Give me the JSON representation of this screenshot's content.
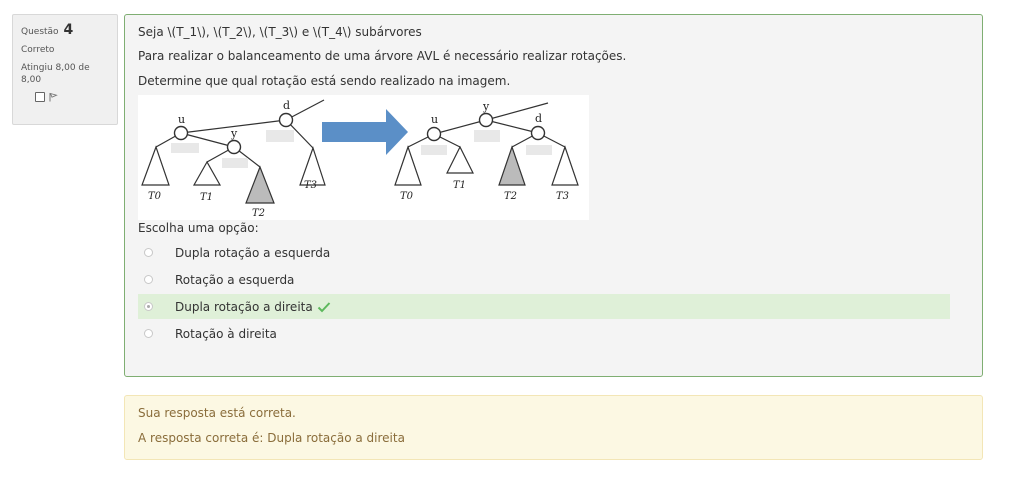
{
  "info": {
    "question_label": "Questão",
    "question_number": "4",
    "state": "Correto",
    "grade": "Atingiu 8,00 de 8,00"
  },
  "question": {
    "line1": "Seja \\(T_1\\), \\(T_2\\), \\(T_3\\) e \\(T_4\\)  subárvores",
    "line2": "Para realizar o balanceamento de uma árvore AVL é necessário realizar rotações.",
    "line3": "Determine que qual rotação está sendo realizado na imagem."
  },
  "figure": {
    "left_nodes": {
      "d": "d",
      "u": "u",
      "y": "y"
    },
    "right_nodes": {
      "d": "d",
      "u": "u",
      "y": "y"
    },
    "subtree_labels": [
      "T0",
      "T1",
      "T2",
      "T3"
    ],
    "arrow_color": "#5b8fc7"
  },
  "prompt": "Escolha uma opção:",
  "options": [
    {
      "label": "Dupla rotação a esquerda",
      "selected": false
    },
    {
      "label": "Rotação a esquerda",
      "selected": false
    },
    {
      "label": "Dupla rotação a direita",
      "selected": true,
      "correct_icon": "check-icon"
    },
    {
      "label": "Rotação à direita",
      "selected": false
    }
  ],
  "feedback": {
    "line1": "Sua resposta está correta.",
    "line2": "A resposta correta é: Dupla rotação a direita"
  },
  "colors": {
    "success_border": "#7fae72",
    "selected_bg": "#dff0d8",
    "feedback_bg": "#fcf8e3",
    "check": "#5cb85c"
  }
}
